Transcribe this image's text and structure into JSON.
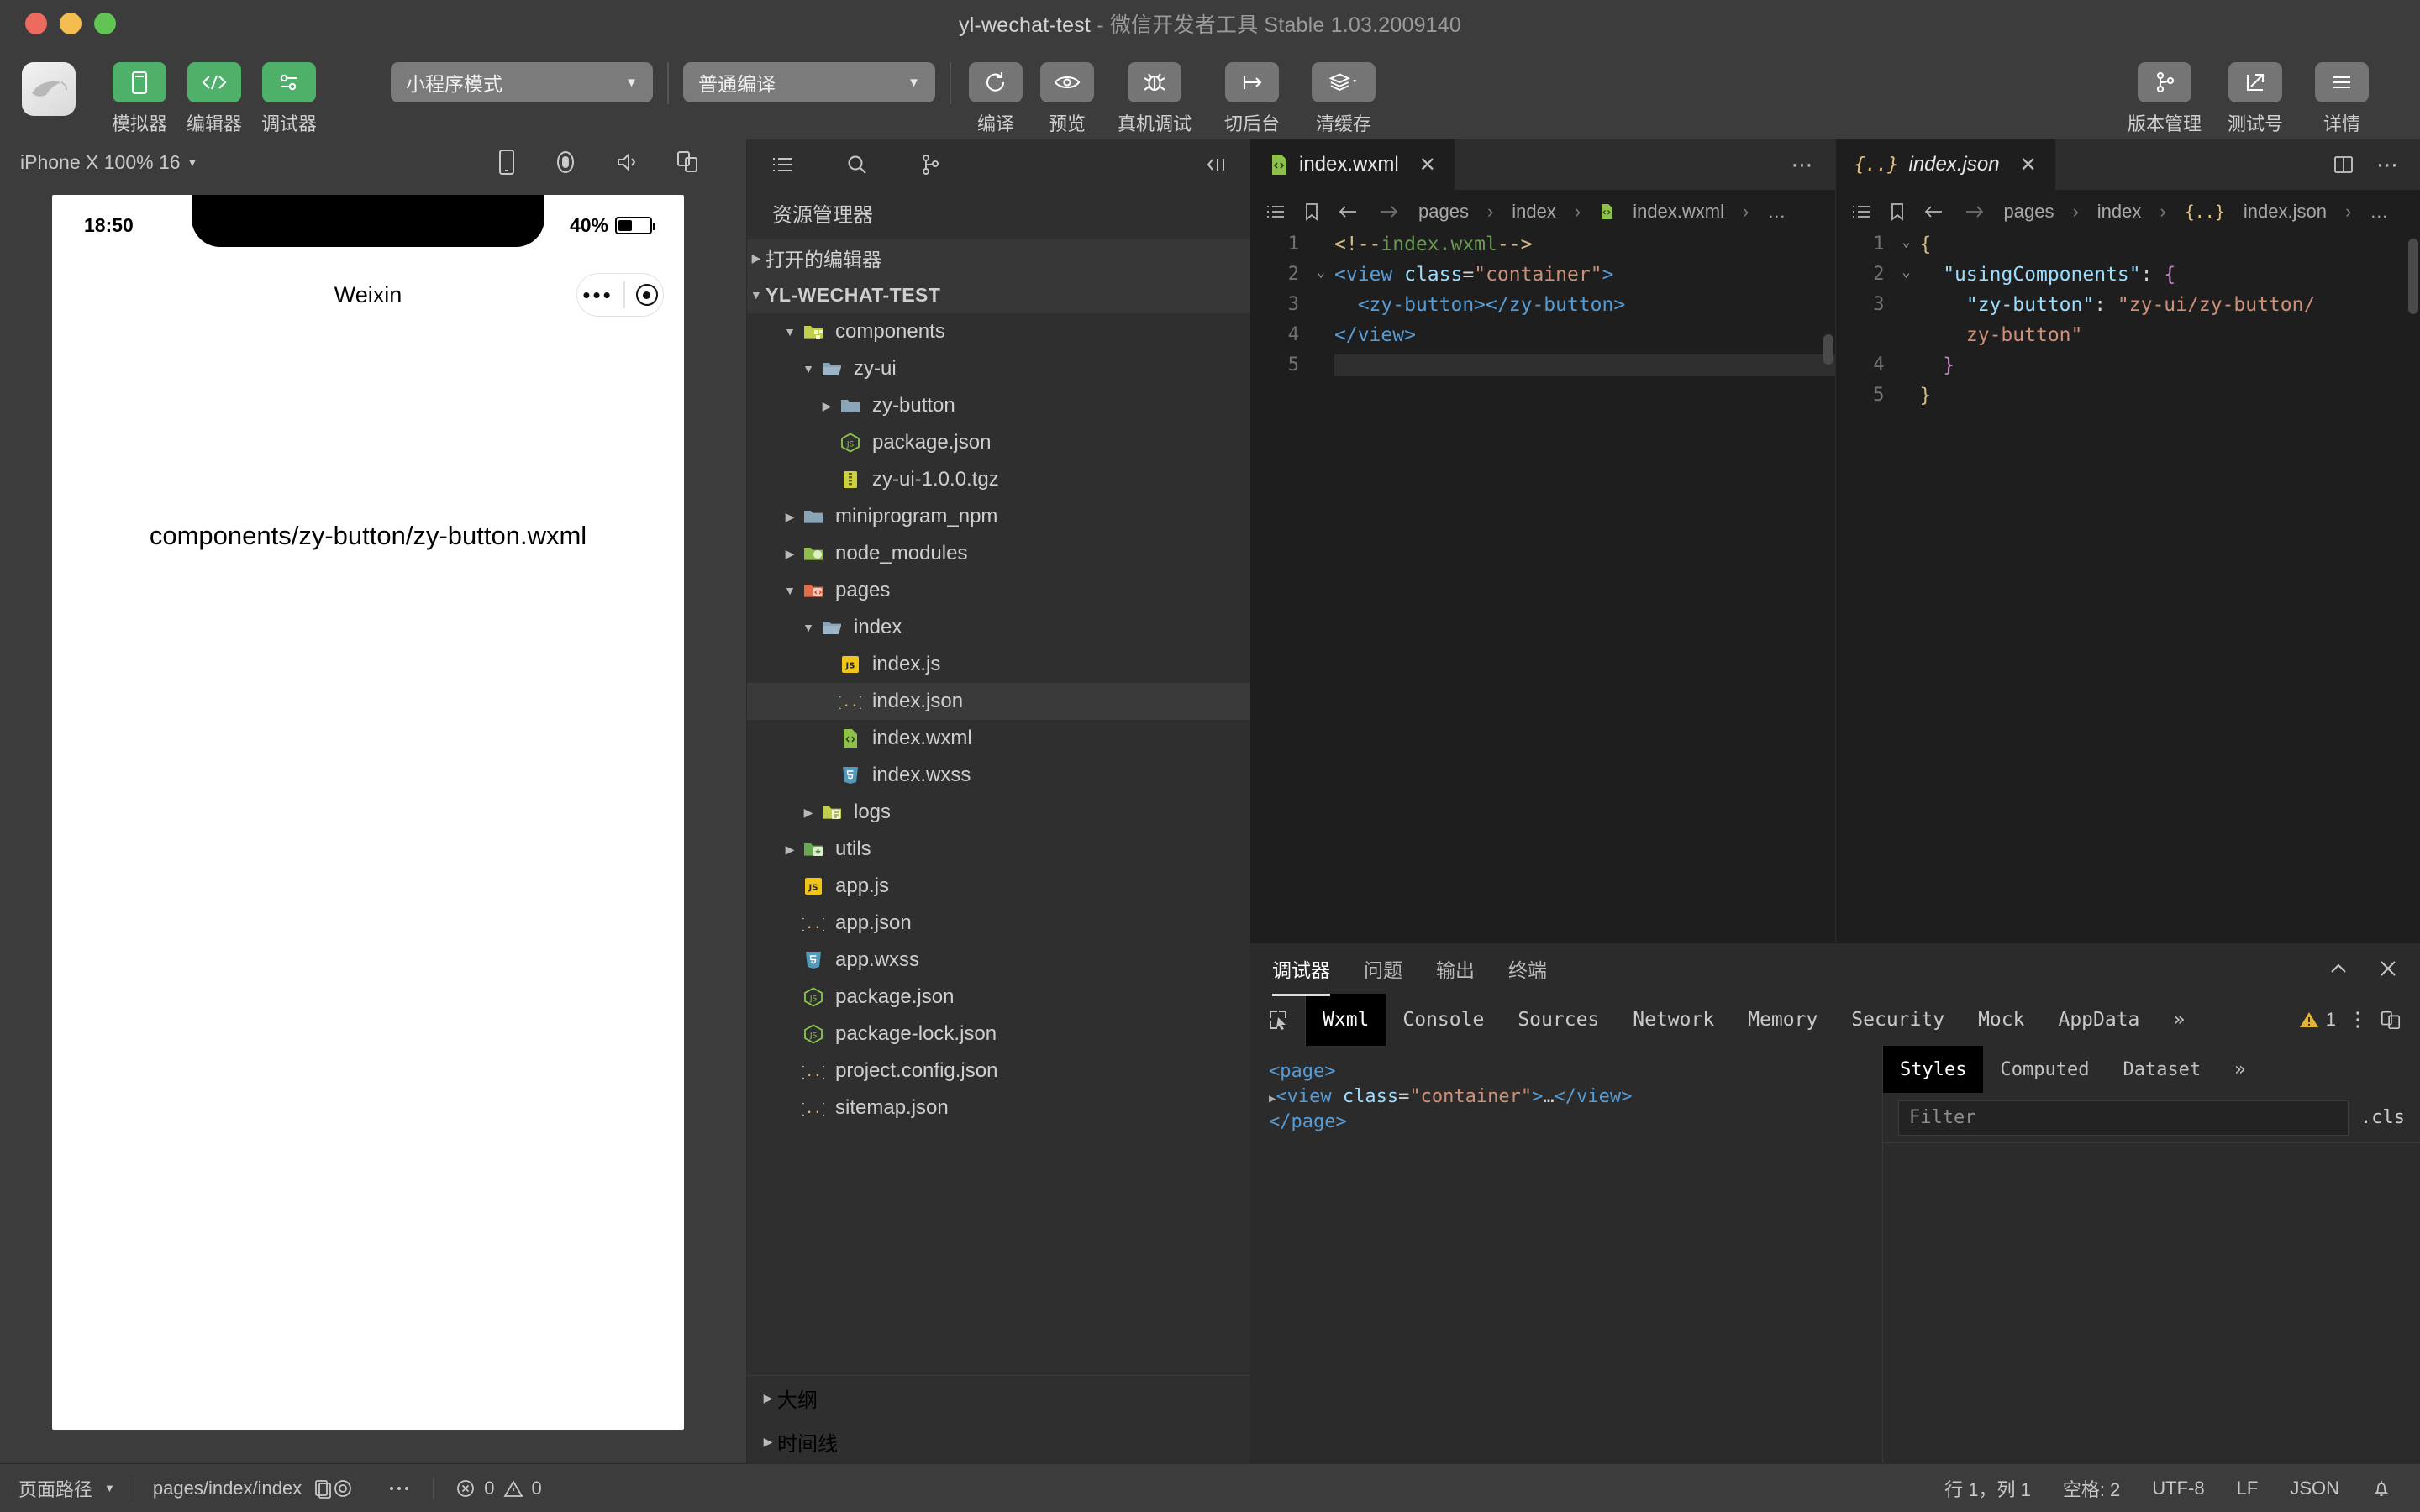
{
  "window": {
    "title_main": "yl-wechat-test",
    "title_dash": "-",
    "title_sub": "微信开发者工具 Stable 1.03.2009140"
  },
  "toolbar": {
    "left_buttons": [
      {
        "label": "模拟器",
        "icon": "simulator-icon"
      },
      {
        "label": "编辑器",
        "icon": "code-icon"
      },
      {
        "label": "调试器",
        "icon": "sliders-icon"
      }
    ],
    "mode_select": "小程序模式",
    "compile_select": "普通编译",
    "actions": [
      {
        "label": "编译",
        "icon": "refresh-icon"
      },
      {
        "label": "预览",
        "icon": "eye-icon"
      },
      {
        "label": "真机调试",
        "icon": "bug-icon"
      },
      {
        "label": "切后台",
        "icon": "background-icon"
      },
      {
        "label": "清缓存",
        "icon": "layers-icon"
      }
    ],
    "right_actions": [
      {
        "label": "版本管理",
        "icon": "branch-icon"
      },
      {
        "label": "测试号",
        "icon": "external-link-icon"
      },
      {
        "label": "详情",
        "icon": "menu-icon"
      }
    ]
  },
  "simulator": {
    "device_label": "iPhone X 100% 16",
    "status_time": "18:50",
    "battery_percent": "40%",
    "nav_title": "Weixin",
    "page_text": "components/zy-button/zy-button.wxml",
    "header_icons": [
      "phone-icon",
      "record-icon",
      "sound-icon",
      "multiwindow-icon"
    ]
  },
  "explorer": {
    "title": "资源管理器",
    "toolbar_icons": [
      "explorer-list-icon",
      "search-icon",
      "source-control-icon",
      "collapse-all-icon"
    ],
    "sections": [
      {
        "label": "打开的编辑器",
        "expanded": false
      },
      {
        "label": "YL-WECHAT-TEST",
        "expanded": true
      }
    ],
    "tree": [
      {
        "label": "components",
        "depth": 1,
        "type": "folder-components",
        "arrow": "down",
        "selected": false
      },
      {
        "label": "zy-ui",
        "depth": 2,
        "type": "folder-open",
        "arrow": "down",
        "selected": false
      },
      {
        "label": "zy-button",
        "depth": 3,
        "type": "folder",
        "arrow": "right",
        "selected": false
      },
      {
        "label": "package.json",
        "depth": 3,
        "type": "npm",
        "arrow": "",
        "selected": false
      },
      {
        "label": "zy-ui-1.0.0.tgz",
        "depth": 3,
        "type": "archive",
        "arrow": "",
        "selected": false
      },
      {
        "label": "miniprogram_npm",
        "depth": 1,
        "type": "folder",
        "arrow": "right",
        "selected": false
      },
      {
        "label": "node_modules",
        "depth": 1,
        "type": "folder-node",
        "arrow": "right",
        "selected": false
      },
      {
        "label": "pages",
        "depth": 1,
        "type": "folder-pages",
        "arrow": "down",
        "selected": false
      },
      {
        "label": "index",
        "depth": 2,
        "type": "folder-open",
        "arrow": "down",
        "selected": false
      },
      {
        "label": "index.js",
        "depth": 3,
        "type": "js",
        "arrow": "",
        "selected": false
      },
      {
        "label": "index.json",
        "depth": 3,
        "type": "json",
        "arrow": "",
        "selected": true
      },
      {
        "label": "index.wxml",
        "depth": 3,
        "type": "wxml",
        "arrow": "",
        "selected": false
      },
      {
        "label": "index.wxss",
        "depth": 3,
        "type": "wxss",
        "arrow": "",
        "selected": false
      },
      {
        "label": "logs",
        "depth": 2,
        "type": "folder-logs",
        "arrow": "right",
        "selected": false
      },
      {
        "label": "utils",
        "depth": 1,
        "type": "folder-utils",
        "arrow": "right",
        "selected": false
      },
      {
        "label": "app.js",
        "depth": 1,
        "type": "js",
        "arrow": "",
        "selected": false
      },
      {
        "label": "app.json",
        "depth": 1,
        "type": "json",
        "arrow": "",
        "selected": false
      },
      {
        "label": "app.wxss",
        "depth": 1,
        "type": "wxss",
        "arrow": "",
        "selected": false
      },
      {
        "label": "package.json",
        "depth": 1,
        "type": "npm",
        "arrow": "",
        "selected": false
      },
      {
        "label": "package-lock.json",
        "depth": 1,
        "type": "npm",
        "arrow": "",
        "selected": false
      },
      {
        "label": "project.config.json",
        "depth": 1,
        "type": "json",
        "arrow": "",
        "selected": false
      },
      {
        "label": "sitemap.json",
        "depth": 1,
        "type": "json",
        "arrow": "",
        "selected": false
      }
    ],
    "footer": [
      {
        "label": "大纲"
      },
      {
        "label": "时间线"
      }
    ]
  },
  "editor_left": {
    "tab_label": "index.wxml",
    "tab_icon": "wxml-file-icon",
    "more": "⋯",
    "breadcrumb": [
      "pages",
      "index",
      "index.wxml",
      "…"
    ],
    "lines": [
      {
        "n": "1",
        "fold": "",
        "html": "<span class='c-comc'>&lt;!--</span><span class='c-com'>index.wxml</span><span class='c-comc'>--&gt;</span>"
      },
      {
        "n": "2",
        "fold": "⌄",
        "html": "<span class='c-tag'>&lt;view</span> <span class='c-attr'>class</span><span class='c-punc'>=</span><span class='c-str'>\"container\"</span><span class='c-tag'>&gt;</span>"
      },
      {
        "n": "3",
        "fold": "",
        "html": "  <span class='c-tag'>&lt;zy-button&gt;&lt;/zy-button&gt;</span>"
      },
      {
        "n": "4",
        "fold": "",
        "html": "<span class='c-tag'>&lt;/view&gt;</span>"
      },
      {
        "n": "5",
        "fold": "",
        "html": ""
      }
    ]
  },
  "editor_right": {
    "tab_label": "index.json",
    "tab_icon": "json-file-icon",
    "split": "split-editor-icon",
    "more": "⋯",
    "breadcrumb": [
      "pages",
      "index",
      "index.json",
      "…"
    ],
    "lines": [
      {
        "n": "1",
        "fold": "⌄",
        "html": "<span class='c-brace'>{</span>"
      },
      {
        "n": "2",
        "fold": "⌄",
        "html": "  <span class='c-key'>\"usingComponents\"</span><span class='c-punc'>: </span><span class='c-pink'>{</span>"
      },
      {
        "n": "3",
        "fold": "",
        "html": "    <span class='c-attr'>\"zy-button\"</span><span class='c-punc'>: </span><span class='c-str'>\"zy-ui/zy-button/</span>"
      },
      {
        "n": "",
        "fold": "",
        "html": "    <span class='c-str'>zy-button\"</span>"
      },
      {
        "n": "4",
        "fold": "",
        "html": "  <span class='c-pink'>}</span>"
      },
      {
        "n": "5",
        "fold": "",
        "html": "<span class='c-brace'>}</span>"
      }
    ]
  },
  "debugger": {
    "panel_tabs": [
      {
        "label": "调试器",
        "active": true
      },
      {
        "label": "问题",
        "active": false
      },
      {
        "label": "输出",
        "active": false
      },
      {
        "label": "终端",
        "active": false
      }
    ],
    "panel_controls": [
      "collapse-icon",
      "close-icon"
    ],
    "devtools_tabs": [
      {
        "label": "Wxml",
        "active": true
      },
      {
        "label": "Console",
        "active": false
      },
      {
        "label": "Sources",
        "active": false
      },
      {
        "label": "Network",
        "active": false
      },
      {
        "label": "Memory",
        "active": false
      },
      {
        "label": "Security",
        "active": false
      },
      {
        "label": "Mock",
        "active": false
      },
      {
        "label": "AppData",
        "active": false
      }
    ],
    "overflow": "»",
    "warning_count": "1",
    "wxml_lines": [
      {
        "indent": 0,
        "tri": false,
        "html": "<span class='c-tag'>&lt;page&gt;</span>"
      },
      {
        "indent": 0,
        "tri": true,
        "html": "<span class='c-tag'>&lt;view</span> <span class='c-attr'>class</span>=<span class='c-str'>\"container\"</span><span class='c-tag'>&gt;</span>…<span class='c-tag'>&lt;/view&gt;</span>"
      },
      {
        "indent": 0,
        "tri": false,
        "html": "<span class='c-tag'>&lt;/page&gt;</span>"
      }
    ],
    "styles_tabs": [
      {
        "label": "Styles",
        "active": true
      },
      {
        "label": "Computed",
        "active": false
      },
      {
        "label": "Dataset",
        "active": false
      }
    ],
    "styles_overflow": "»",
    "filter_placeholder": "Filter",
    "cls_label": ".cls"
  },
  "status_bar": {
    "path_label": "页面路径",
    "path_value": "pages/index/index",
    "copy_icon": "copy-icon",
    "eye_icon": "eye-icon",
    "more_icon": "more-icon",
    "error_count": "0",
    "warning_count": "0",
    "position": "行 1，列 1",
    "spaces": "空格: 2",
    "encoding": "UTF-8",
    "eol": "LF",
    "language": "JSON",
    "bell_icon": "bell-icon"
  },
  "colors": {
    "accent_green": "#4fb06a",
    "window_bg": "#3c3c3c",
    "editor_bg": "#1e1e1e",
    "panel_bg": "#2b2b2b",
    "explorer_bg": "#2f2f2f"
  }
}
